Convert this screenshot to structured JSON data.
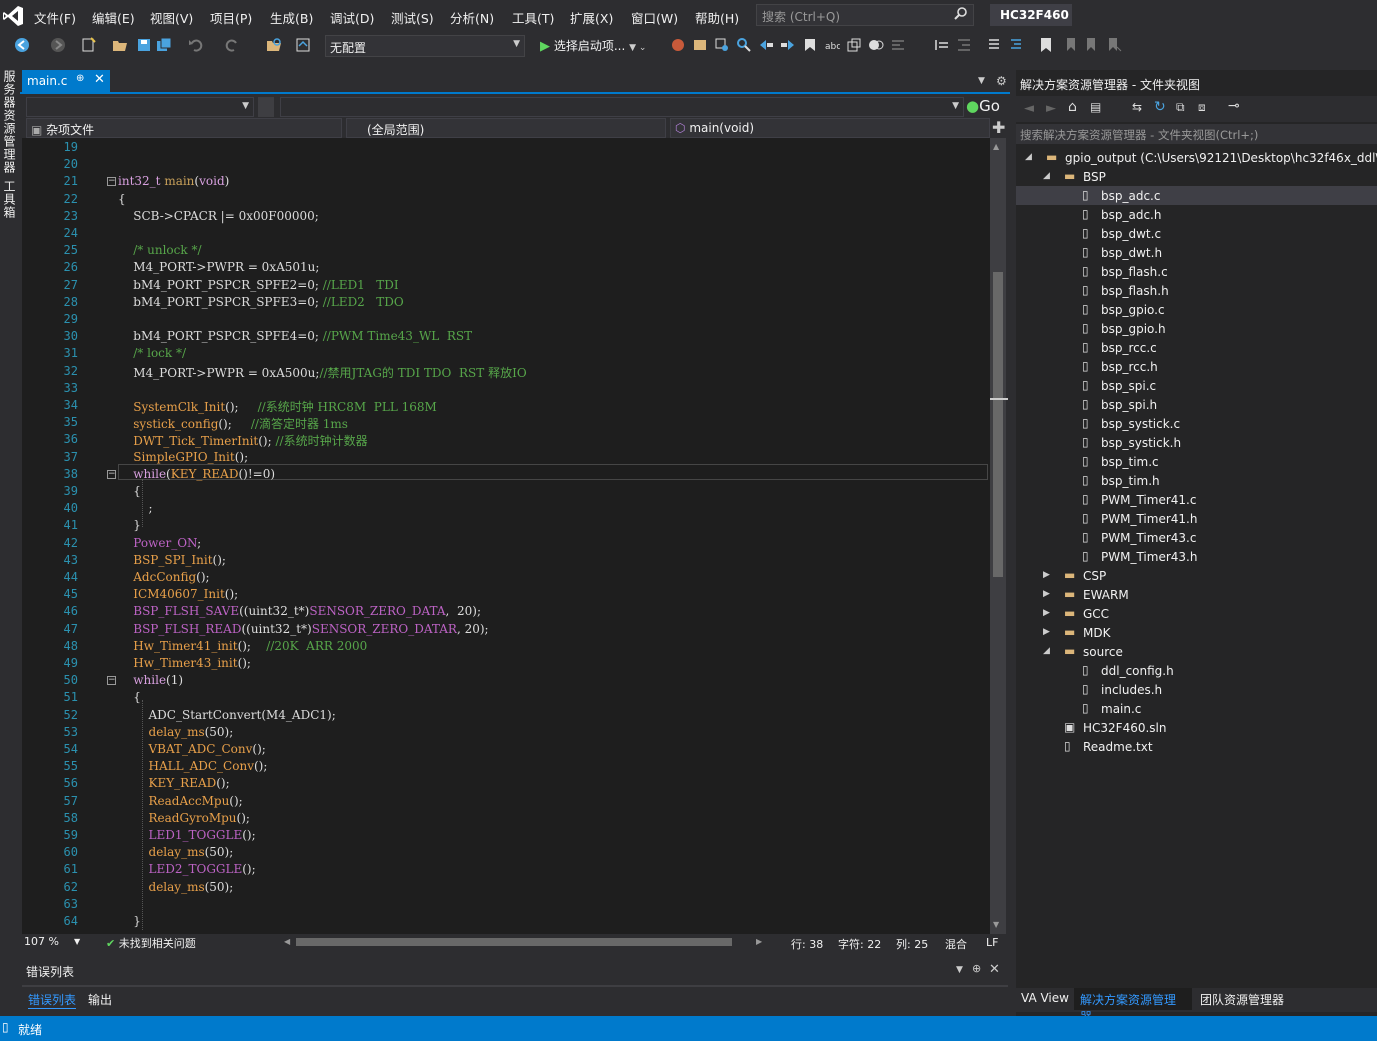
{
  "menu": [
    "文件(F)",
    "编辑(E)",
    "视图(V)",
    "项目(P)",
    "生成(B)",
    "调试(D)",
    "测试(S)",
    "分析(N)",
    "工具(T)",
    "扩展(X)",
    "窗口(W)",
    "帮助(H)"
  ],
  "search_placeholder": "搜索 (Ctrl+Q)",
  "project_title": "HC32F460",
  "toolbar": {
    "config": "无配置",
    "start": "选择启动项..."
  },
  "left_strip": [
    "服务器资源管理器",
    "工具箱"
  ],
  "tab": {
    "name": "main.c"
  },
  "nav": {
    "go": "Go",
    "file_scope": "杂项文件",
    "global_scope": "(全局范围)",
    "function": "main(void)"
  },
  "editor": {
    "lines": [
      {
        "n": "19",
        "t": ""
      },
      {
        "n": "20",
        "t": ""
      },
      {
        "n": "21",
        "t": "int32_t main(void)"
      },
      {
        "n": "22",
        "t": "{"
      },
      {
        "n": "23",
        "t": "    SCB->CPACR |= 0x00F00000;"
      },
      {
        "n": "24",
        "t": ""
      },
      {
        "n": "25",
        "t": "    /* unlock */"
      },
      {
        "n": "26",
        "t": "    M4_PORT->PWPR = 0xA501u;"
      },
      {
        "n": "27",
        "t": "    bM4_PORT_PSPCR_SPFE2=0; //LED1   TDI"
      },
      {
        "n": "28",
        "t": "    bM4_PORT_PSPCR_SPFE3=0; //LED2   TDO"
      },
      {
        "n": "29",
        "t": ""
      },
      {
        "n": "30",
        "t": "    bM4_PORT_PSPCR_SPFE4=0; //PWM Time43_WL  RST"
      },
      {
        "n": "31",
        "t": "    /* lock */"
      },
      {
        "n": "32",
        "t": "    M4_PORT->PWPR = 0xA500u;//禁用JTAG的 TDI TDO  RST 释放IO"
      },
      {
        "n": "33",
        "t": ""
      },
      {
        "n": "34",
        "t": "    SystemClk_Init();     //系统时钟 HRC8M  PLL 168M"
      },
      {
        "n": "35",
        "t": "    systick_config();     //滴答定时器 1ms"
      },
      {
        "n": "36",
        "t": "    DWT_Tick_TimerInit(); //系统时钟计数器"
      },
      {
        "n": "37",
        "t": "    SimpleGPIO_Init();"
      },
      {
        "n": "38",
        "t": "    while(KEY_READ()!=0)"
      },
      {
        "n": "39",
        "t": "    {"
      },
      {
        "n": "40",
        "t": "        ;"
      },
      {
        "n": "41",
        "t": "    }"
      },
      {
        "n": "42",
        "t": "    Power_ON;"
      },
      {
        "n": "43",
        "t": "    BSP_SPI_Init();"
      },
      {
        "n": "44",
        "t": "    AdcConfig();"
      },
      {
        "n": "45",
        "t": "    ICM40607_Init();"
      },
      {
        "n": "46",
        "t": "    BSP_FLSH_SAVE((uint32_t*)SENSOR_ZERO_DATA,  20);"
      },
      {
        "n": "47",
        "t": "    BSP_FLSH_READ((uint32_t*)SENSOR_ZERO_DATAR, 20);"
      },
      {
        "n": "48",
        "t": "    Hw_Timer41_init();    //20K  ARR 2000"
      },
      {
        "n": "49",
        "t": "    Hw_Timer43_init();"
      },
      {
        "n": "50",
        "t": "    while(1)"
      },
      {
        "n": "51",
        "t": "    {"
      },
      {
        "n": "52",
        "t": "        ADC_StartConvert(M4_ADC1);"
      },
      {
        "n": "53",
        "t": "        delay_ms(50);"
      },
      {
        "n": "54",
        "t": "        VBAT_ADC_Conv();"
      },
      {
        "n": "55",
        "t": "        HALL_ADC_Conv();"
      },
      {
        "n": "56",
        "t": "        KEY_READ();"
      },
      {
        "n": "57",
        "t": "        ReadAccMpu();"
      },
      {
        "n": "58",
        "t": "        ReadGyroMpu();"
      },
      {
        "n": "59",
        "t": "        LED1_TOGGLE();"
      },
      {
        "n": "60",
        "t": "        delay_ms(50);"
      },
      {
        "n": "61",
        "t": "        LED2_TOGGLE();"
      },
      {
        "n": "62",
        "t": "        delay_ms(50);"
      },
      {
        "n": "63",
        "t": ""
      },
      {
        "n": "64",
        "t": "    }"
      }
    ]
  },
  "editor_status": {
    "zoom": "107 %",
    "issues": "未找到相关问题",
    "line": "行: 38",
    "char": "字符: 22",
    "col": "列: 25",
    "mix": "混合",
    "eol": "LF"
  },
  "error_panel": {
    "title": "错误列表",
    "tabs": [
      "错误列表",
      "输出"
    ]
  },
  "solution": {
    "title": "解决方案资源管理器 - 文件夹视图",
    "search": "搜索解决方案资源管理器 - 文件夹视图(Ctrl+;)",
    "root": "gpio_output (C:\\Users\\92121\\Desktop\\hc32f46x_ddl\\e",
    "bsp": "BSP",
    "bsp_files": [
      "bsp_adc.c",
      "bsp_adc.h",
      "bsp_dwt.c",
      "bsp_dwt.h",
      "bsp_flash.c",
      "bsp_flash.h",
      "bsp_gpio.c",
      "bsp_gpio.h",
      "bsp_rcc.c",
      "bsp_rcc.h",
      "bsp_spi.c",
      "bsp_spi.h",
      "bsp_systick.c",
      "bsp_systick.h",
      "bsp_tim.c",
      "bsp_tim.h",
      "PWM_Timer41.c",
      "PWM_Timer41.h",
      "PWM_Timer43.c",
      "PWM_Timer43.h"
    ],
    "folders": [
      "CSP",
      "EWARM",
      "GCC",
      "MDK"
    ],
    "source": "source",
    "source_files": [
      "ddl_config.h",
      "includes.h",
      "main.c"
    ],
    "sln": "HC32F460.sln",
    "readme": "Readme.txt"
  },
  "right_tabs": [
    "VA View",
    "解决方案资源管理器",
    "团队资源管理器"
  ],
  "status": "就绪",
  "colors": {
    "accent": "#007acc",
    "bg": "#1e1e1e",
    "linenum": "#2b91af",
    "comment": "#57a64a",
    "macro": "#bd63c5",
    "func": "#c8a05a"
  }
}
